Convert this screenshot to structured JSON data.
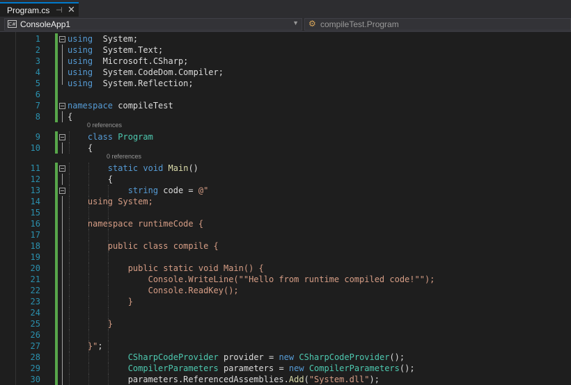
{
  "tab": {
    "title": "Program.cs",
    "pin_glyph": "⊣",
    "close_glyph": "✕"
  },
  "nav": {
    "project": "ConsoleApp1",
    "project_icon_text": "C#",
    "scope": "compileTest.Program"
  },
  "lens": {
    "class_refs": "0 references",
    "method_refs": "0 references"
  },
  "lines": [
    {
      "n": "1",
      "segs": [
        [
          "kw",
          "using"
        ],
        [
          "",
          "  System;"
        ]
      ]
    },
    {
      "n": "2",
      "segs": [
        [
          "kw",
          "using"
        ],
        [
          "",
          "  System.Text;"
        ]
      ]
    },
    {
      "n": "3",
      "segs": [
        [
          "kw",
          "using"
        ],
        [
          "",
          "  Microsoft.CSharp;"
        ]
      ]
    },
    {
      "n": "4",
      "segs": [
        [
          "kw",
          "using"
        ],
        [
          "",
          "  System.CodeDom.Compiler;"
        ]
      ]
    },
    {
      "n": "5",
      "segs": [
        [
          "kw",
          "using"
        ],
        [
          "",
          "  System.Reflection;"
        ]
      ]
    },
    {
      "n": "6",
      "segs": []
    },
    {
      "n": "7",
      "segs": [
        [
          "kw",
          "namespace"
        ],
        [
          "",
          " compileTest"
        ]
      ]
    },
    {
      "n": "8",
      "segs": [
        [
          "",
          "{"
        ]
      ]
    },
    {
      "n": "9",
      "segs": [
        [
          "",
          "    "
        ],
        [
          "kw",
          "class"
        ],
        [
          "",
          " "
        ],
        [
          "ty",
          "Program"
        ]
      ]
    },
    {
      "n": "10",
      "segs": [
        [
          "",
          "    {"
        ]
      ]
    },
    {
      "n": "11",
      "segs": [
        [
          "",
          "        "
        ],
        [
          "kw",
          "static"
        ],
        [
          "",
          " "
        ],
        [
          "kw",
          "void"
        ],
        [
          "",
          " "
        ],
        [
          "mt",
          "Main"
        ],
        [
          "",
          "()"
        ]
      ]
    },
    {
      "n": "12",
      "segs": [
        [
          "",
          "        {"
        ]
      ]
    },
    {
      "n": "13",
      "segs": [
        [
          "",
          "            "
        ],
        [
          "kw",
          "string"
        ],
        [
          "",
          " code = "
        ],
        [
          "st",
          "@\""
        ]
      ]
    },
    {
      "n": "14",
      "segs": [
        [
          "st",
          "    using System;"
        ]
      ]
    },
    {
      "n": "15",
      "segs": []
    },
    {
      "n": "16",
      "segs": [
        [
          "st",
          "    namespace runtimeCode {"
        ]
      ]
    },
    {
      "n": "17",
      "segs": []
    },
    {
      "n": "18",
      "segs": [
        [
          "st",
          "        public class compile {"
        ]
      ]
    },
    {
      "n": "19",
      "segs": []
    },
    {
      "n": "20",
      "segs": [
        [
          "st",
          "            public static void Main() {"
        ]
      ]
    },
    {
      "n": "21",
      "segs": [
        [
          "st",
          "                Console.WriteLine(\"\"Hello from runtime compiled code!\"\");"
        ]
      ]
    },
    {
      "n": "22",
      "segs": [
        [
          "st",
          "                Console.ReadKey();"
        ]
      ]
    },
    {
      "n": "23",
      "segs": [
        [
          "st",
          "            }"
        ]
      ]
    },
    {
      "n": "24",
      "segs": []
    },
    {
      "n": "25",
      "segs": [
        [
          "st",
          "        }"
        ]
      ]
    },
    {
      "n": "26",
      "segs": []
    },
    {
      "n": "27",
      "segs": [
        [
          "st",
          "    }\""
        ],
        [
          "",
          ";"
        ]
      ]
    },
    {
      "n": "28",
      "segs": [
        [
          "",
          "            "
        ],
        [
          "ct",
          "CSharpCodeProvider"
        ],
        [
          "",
          " provider = "
        ],
        [
          "kw",
          "new"
        ],
        [
          "",
          " "
        ],
        [
          "ct",
          "CSharpCodeProvider"
        ],
        [
          "",
          "();"
        ]
      ]
    },
    {
      "n": "29",
      "segs": [
        [
          "",
          "            "
        ],
        [
          "ct",
          "CompilerParameters"
        ],
        [
          "",
          " parameters = "
        ],
        [
          "kw",
          "new"
        ],
        [
          "",
          " "
        ],
        [
          "ct",
          "CompilerParameters"
        ],
        [
          "",
          "();"
        ]
      ]
    },
    {
      "n": "30",
      "segs": [
        [
          "",
          "            parameters.ReferencedAssemblies."
        ],
        [
          "mt",
          "Add"
        ],
        [
          "",
          "("
        ],
        [
          "st",
          "\"System.dll\""
        ],
        [
          "",
          ");"
        ]
      ]
    }
  ]
}
